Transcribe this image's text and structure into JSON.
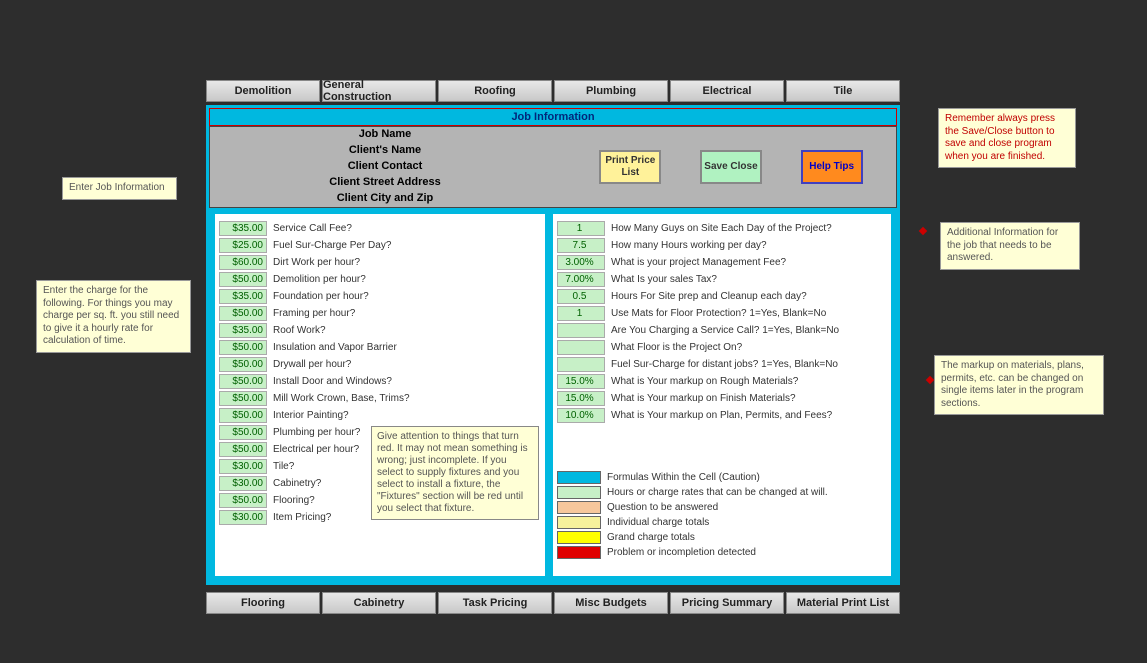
{
  "tabs_top": [
    "Demolition",
    "General Construction",
    "Roofing",
    "Plumbing",
    "Electrical",
    "Tile"
  ],
  "tabs_bottom": [
    "Flooring",
    "Cabinetry",
    "Task Pricing",
    "Misc Budgets",
    "Pricing Summary",
    "Material Print List"
  ],
  "title": "Job Information",
  "header_labels": [
    "Job Name",
    "Client's Name",
    "Client Contact",
    "Client Street Address",
    "Client City and Zip"
  ],
  "buttons": {
    "print": "Print Price List",
    "save": "Save Close",
    "help": "Help Tips"
  },
  "left_rows": [
    {
      "v": "$35.00",
      "l": "Service Call Fee?"
    },
    {
      "v": "$25.00",
      "l": "Fuel Sur-Charge Per Day?"
    },
    {
      "v": "$60.00",
      "l": "Dirt Work per hour?"
    },
    {
      "v": "$50.00",
      "l": "Demolition per hour?"
    },
    {
      "v": "$35.00",
      "l": "Foundation per hour?"
    },
    {
      "v": "$50.00",
      "l": "Framing per hour?"
    },
    {
      "v": "$35.00",
      "l": "Roof Work?"
    },
    {
      "v": "$50.00",
      "l": "Insulation and Vapor Barrier"
    },
    {
      "v": "$50.00",
      "l": "Drywall per hour?"
    },
    {
      "v": "$50.00",
      "l": "Install Door and Windows?"
    },
    {
      "v": "$50.00",
      "l": "Mill Work Crown, Base, Trims?"
    },
    {
      "v": "$50.00",
      "l": "Interior Painting?"
    },
    {
      "v": "$50.00",
      "l": "Plumbing per hour?"
    },
    {
      "v": "$50.00",
      "l": "Electrical per hour?"
    },
    {
      "v": "$30.00",
      "l": "Tile?"
    },
    {
      "v": "$30.00",
      "l": "Cabinetry?"
    },
    {
      "v": "$50.00",
      "l": "Flooring?"
    },
    {
      "v": "$30.00",
      "l": "Item Pricing?"
    }
  ],
  "right_rows": [
    {
      "v": "1",
      "l": "How Many Guys on Site Each Day of the Project?"
    },
    {
      "v": "7.5",
      "l": "How many Hours working per day?"
    },
    {
      "v": "3.00%",
      "l": "What is your project Management Fee?"
    },
    {
      "v": "7.00%",
      "l": "What Is your sales Tax?"
    },
    {
      "v": "0.5",
      "l": "Hours For Site prep and Cleanup each day?"
    },
    {
      "v": "1",
      "l": "Use Mats for Floor Protection? 1=Yes, Blank=No"
    },
    {
      "v": "",
      "l": "Are You Charging a Service Call? 1=Yes, Blank=No"
    },
    {
      "v": "",
      "l": "What Floor is the Project On?"
    },
    {
      "v": "",
      "l": "Fuel Sur-Charge for distant jobs?  1=Yes, Blank=No"
    },
    {
      "v": "15.0%",
      "l": "What is Your markup on Rough Materials?"
    },
    {
      "v": "15.0%",
      "l": "What is Your markup on Finish Materials?"
    },
    {
      "v": "10.0%",
      "l": "What is Your markup on Plan, Permits, and Fees?"
    }
  ],
  "legend": [
    {
      "c": "#00b8e0",
      "t": "Formulas Within the Cell (Caution)"
    },
    {
      "c": "#c7f0c7",
      "t": "Hours or charge rates that can be changed at will."
    },
    {
      "c": "#f6c79c",
      "t": "Question to be answered"
    },
    {
      "c": "#f6f29c",
      "t": "Individual charge totals"
    },
    {
      "c": "#ffff00",
      "t": "Grand charge totals"
    },
    {
      "c": "#e00000",
      "t": "Problem or incompletion detected"
    }
  ],
  "callouts": {
    "enter_job": "Enter Job Information",
    "enter_charge": "Enter the charge for the following.  For things you may charge per sq. ft. you still need to give it a hourly rate for calculation of time.",
    "remember": "Remember always press the Save/Close button to save and close program when you are finished.",
    "additional": "Additional Information for the job that needs to be answered.",
    "markup": "The markup on materials, plans, permits, etc. can be changed on single items later in the program sections.",
    "attention": "Give attention to things that turn red.  It may not mean something is wrong; just incomplete.  If you select to supply fixtures and you select to install a fixture, the \"Fixtures\" section will be red until you select that fixture."
  }
}
